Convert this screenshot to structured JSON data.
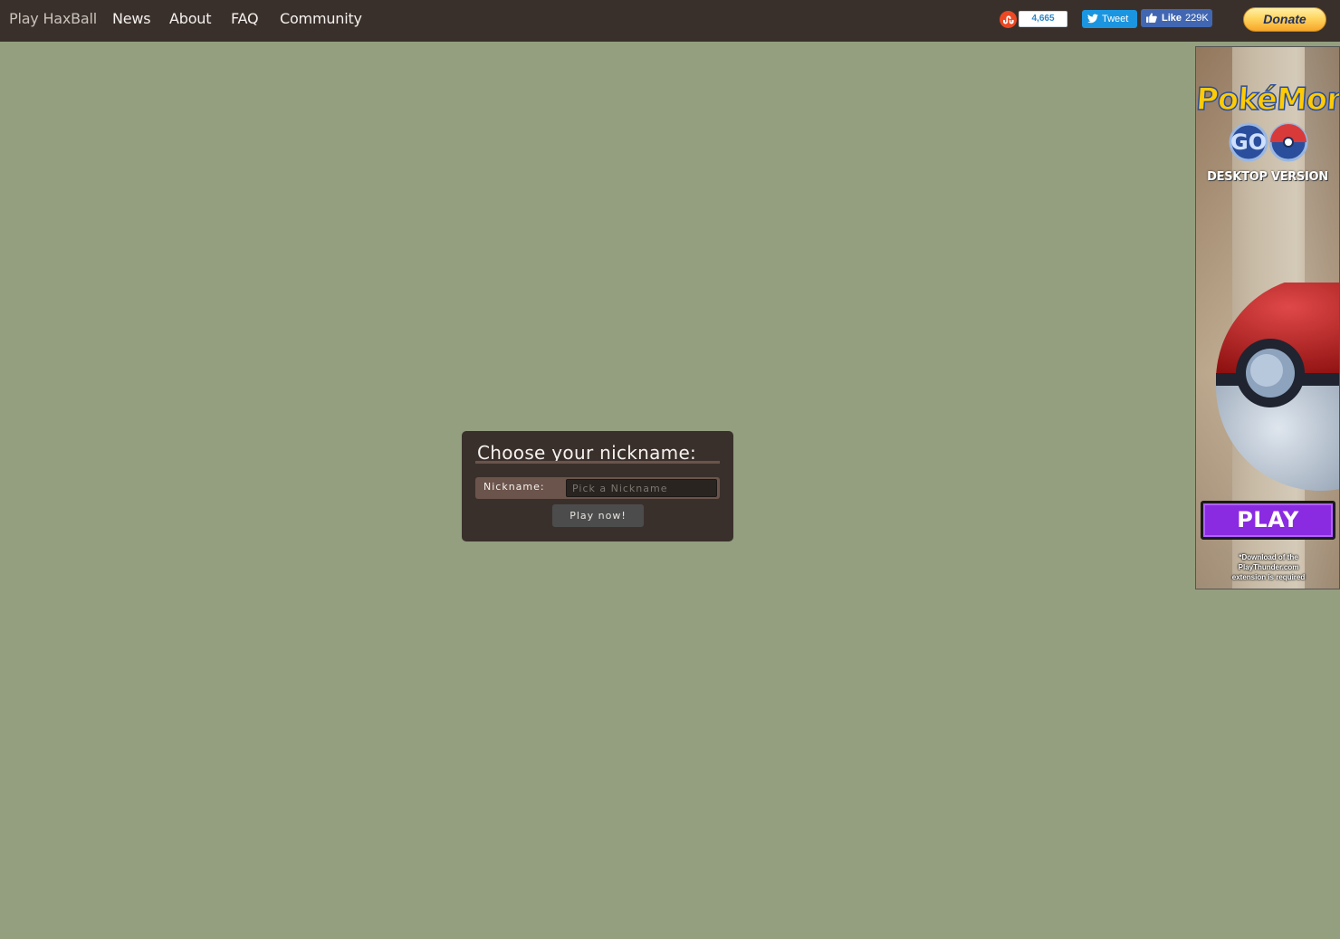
{
  "nav": {
    "brand": "Play HaxBall",
    "items": [
      "News",
      "About",
      "FAQ",
      "Community"
    ]
  },
  "social": {
    "stumbleupon_count": "4,665",
    "tweet_label": "Tweet",
    "fb_like_label": "Like",
    "fb_like_count": "229K",
    "donate_label": "Donate"
  },
  "dialog": {
    "title": "Choose your nickname:",
    "nickname_label": "Nickname:",
    "nickname_value": "",
    "nickname_placeholder": "Pick a Nickname",
    "play_button": "Play now!"
  },
  "ad": {
    "logo_text": "PokéMon",
    "go_text": "GO",
    "subtitle": "DESKTOP VERSION",
    "cta": "PLAY",
    "disclaimer_line1": "*Download of the",
    "disclaimer_line2": "PlayThunder.com",
    "disclaimer_line3": "extension is required"
  },
  "colors": {
    "background": "#939f7f",
    "topbar": "#3a302b",
    "dialog": "#3a302b",
    "accent_brown": "#6b544b",
    "ad_play": "#8a2be2"
  }
}
